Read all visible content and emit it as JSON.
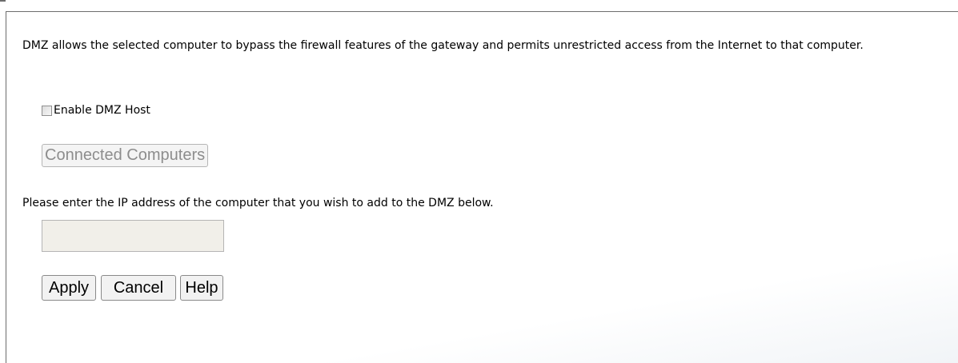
{
  "description": "DMZ allows the selected computer to bypass the firewall features of the gateway and permits unrestricted access from the Internet to that computer.",
  "enable_dmz": {
    "label": "Enable DMZ Host",
    "checked": false
  },
  "connected_computers_button": "Connected Computers",
  "ip_prompt": "Please enter the IP address of the computer that you wish to add to the DMZ below.",
  "ip_input": {
    "value": "",
    "placeholder": ""
  },
  "actions": {
    "apply": "Apply",
    "cancel": "Cancel",
    "help": "Help"
  }
}
